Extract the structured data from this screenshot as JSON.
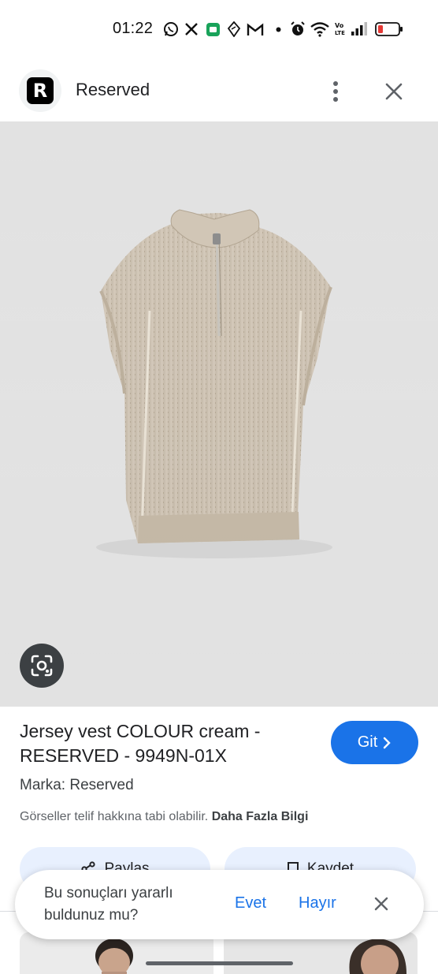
{
  "status_bar": {
    "time": "01:22",
    "icons": [
      "whatsapp-icon",
      "x-icon",
      "app-icon",
      "maps-icon",
      "gmail-icon",
      "dot-icon",
      "alarm-icon",
      "wifi-icon",
      "volte-icon",
      "signal-icon",
      "battery-icon"
    ]
  },
  "header": {
    "logo_letter": "R",
    "site_name": "Reserved"
  },
  "product": {
    "title": "Jersey vest COLOUR cream - RESERVED - 9949N-01X",
    "go_label": "Git",
    "brand": "Marka: Reserved",
    "copyright_note": "Görseller telif hakkına tabi olabilir.",
    "learn_more": "Daha Fazla Bilgi"
  },
  "actions": {
    "share_label": "Paylaş",
    "save_label": "Kaydet"
  },
  "feedback": {
    "question": "Bu sonuçları yararlı buldunuz mu?",
    "yes": "Evet",
    "no": "Hayır"
  },
  "colors": {
    "accent": "#1a73e8",
    "garment": "#cbbfae",
    "image_bg": "#e5e5e5"
  }
}
